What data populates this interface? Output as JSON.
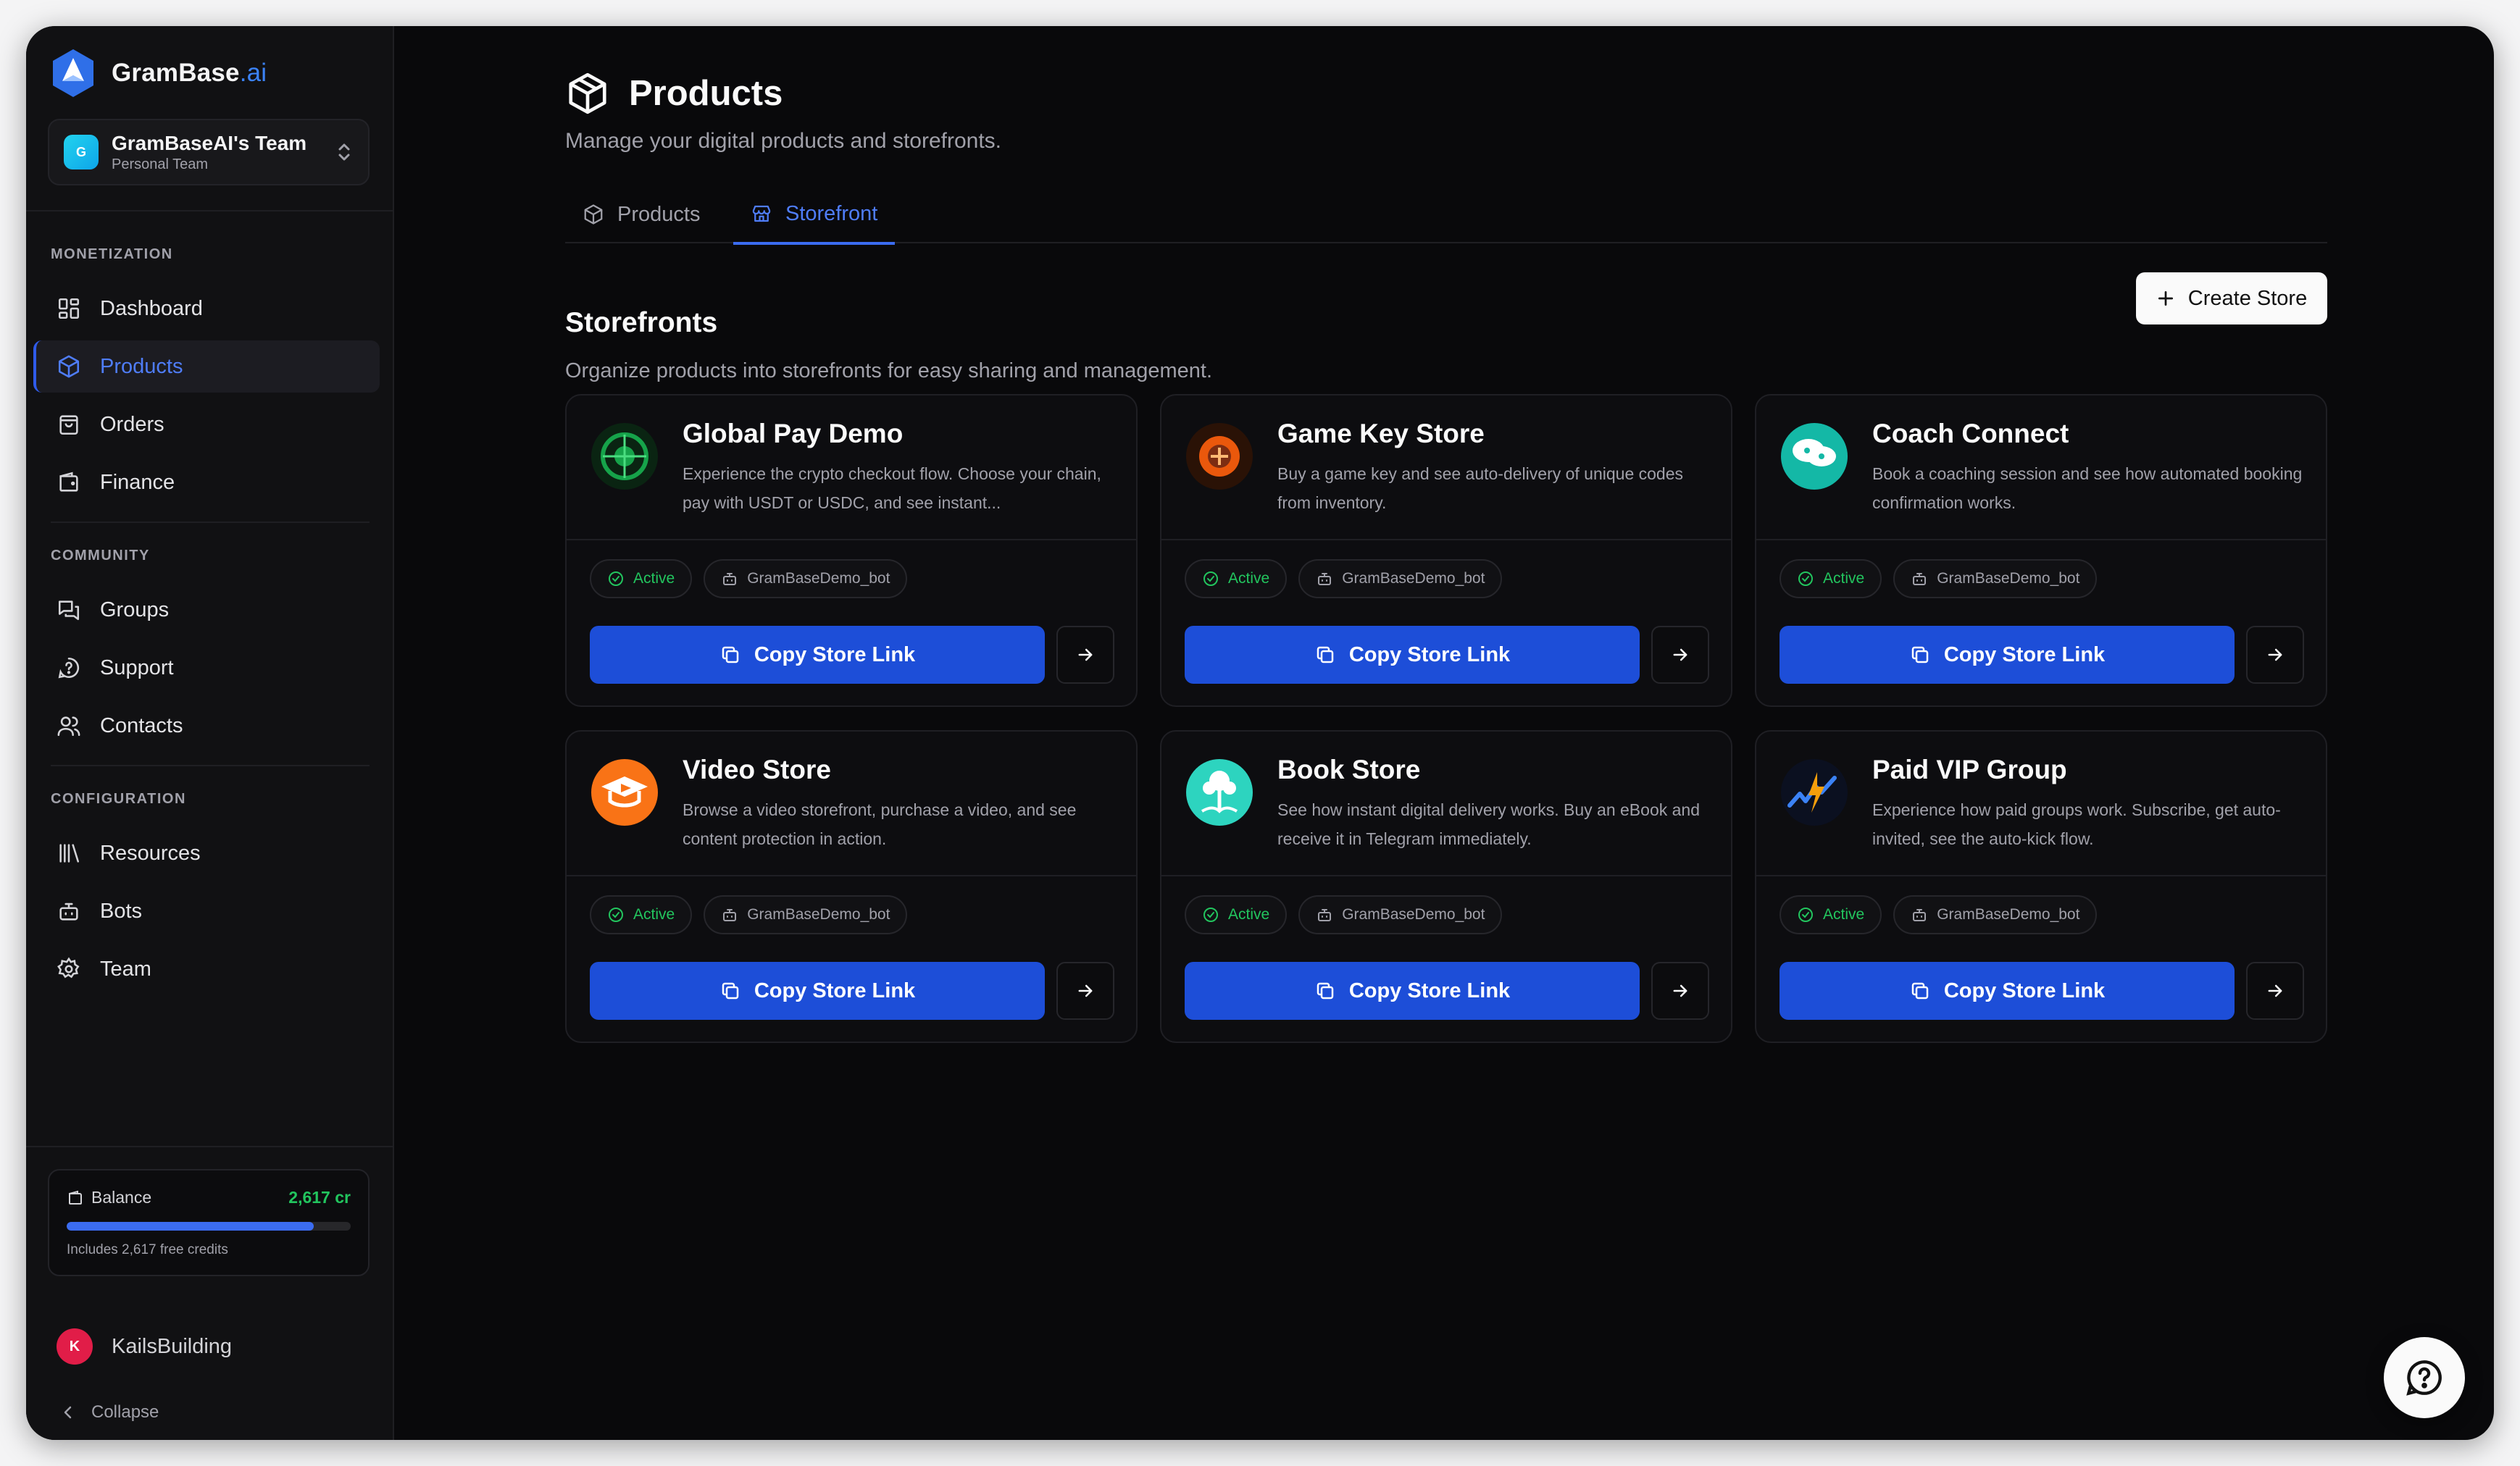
{
  "brand": {
    "name": "GramBase",
    "suffix": ".ai"
  },
  "team": {
    "avatar_letter": "G",
    "name": "GramBaseAI's Team",
    "sub": "Personal Team"
  },
  "sidebar": {
    "sections": [
      {
        "label": "MONETIZATION"
      },
      {
        "label": "COMMUNITY"
      },
      {
        "label": "CONFIGURATION"
      }
    ],
    "items": [
      {
        "label": "Dashboard",
        "icon": "dashboard-icon"
      },
      {
        "label": "Products",
        "icon": "box-icon",
        "active": true
      },
      {
        "label": "Orders",
        "icon": "bag-icon"
      },
      {
        "label": "Finance",
        "icon": "wallet-icon"
      },
      {
        "label": "Groups",
        "icon": "chat-icon"
      },
      {
        "label": "Support",
        "icon": "help-icon"
      },
      {
        "label": "Contacts",
        "icon": "users-icon"
      },
      {
        "label": "Resources",
        "icon": "library-icon"
      },
      {
        "label": "Bots",
        "icon": "bot-icon"
      },
      {
        "label": "Team",
        "icon": "gear-icon"
      }
    ]
  },
  "balance": {
    "label": "Balance",
    "value": "2,617 cr",
    "fill_fraction": 0.87,
    "note": "Includes 2,617 free credits"
  },
  "user": {
    "avatar_letter": "K",
    "name": "KailsBuilding"
  },
  "collapse_label": "Collapse",
  "page": {
    "title": "Products",
    "subtitle": "Manage your digital products and storefronts.",
    "tabs": [
      {
        "label": "Products"
      },
      {
        "label": "Storefront",
        "active": true
      }
    ],
    "section_title": "Storefronts",
    "section_subtitle": "Organize products into storefronts for easy sharing and management.",
    "create_label": "Create Store"
  },
  "stores": [
    {
      "title": "Global Pay Demo",
      "desc": "Experience the crypto checkout flow. Choose your chain, pay with USDT or USDC, and see instant...",
      "status": "Active",
      "bot": "GramBaseDemo_bot",
      "copy_label": "Copy Store Link",
      "icon": "crypto-globe-icon",
      "color": "#16a34a"
    },
    {
      "title": "Game Key Store",
      "desc": "Buy a game key and see auto-delivery of unique codes from inventory.",
      "status": "Active",
      "bot": "GramBaseDemo_bot",
      "copy_label": "Copy Store Link",
      "icon": "game-key-icon",
      "color": "#ea580c"
    },
    {
      "title": "Coach Connect",
      "desc": "Book a coaching session and see how automated booking confirmation works.",
      "status": "Active",
      "bot": "GramBaseDemo_bot",
      "copy_label": "Copy Store Link",
      "icon": "coach-chat-icon",
      "color": "#14b8a6"
    },
    {
      "title": "Video Store",
      "desc": "Browse a video storefront, purchase a video, and see content protection in action.",
      "status": "Active",
      "bot": "GramBaseDemo_bot",
      "copy_label": "Copy Store Link",
      "icon": "video-cap-icon",
      "color": "#f97316"
    },
    {
      "title": "Book Store",
      "desc": "See how instant digital delivery works. Buy an eBook and receive it in Telegram immediately.",
      "status": "Active",
      "bot": "GramBaseDemo_bot",
      "copy_label": "Copy Store Link",
      "icon": "book-tree-icon",
      "color": "#2dd4bf"
    },
    {
      "title": "Paid VIP Group",
      "desc": "Experience how paid groups work. Subscribe, get auto-invited, see the auto-kick flow.",
      "status": "Active",
      "bot": "GramBaseDemo_bot",
      "copy_label": "Copy Store Link",
      "icon": "vip-lightning-icon",
      "color": "#3b82f6"
    }
  ]
}
